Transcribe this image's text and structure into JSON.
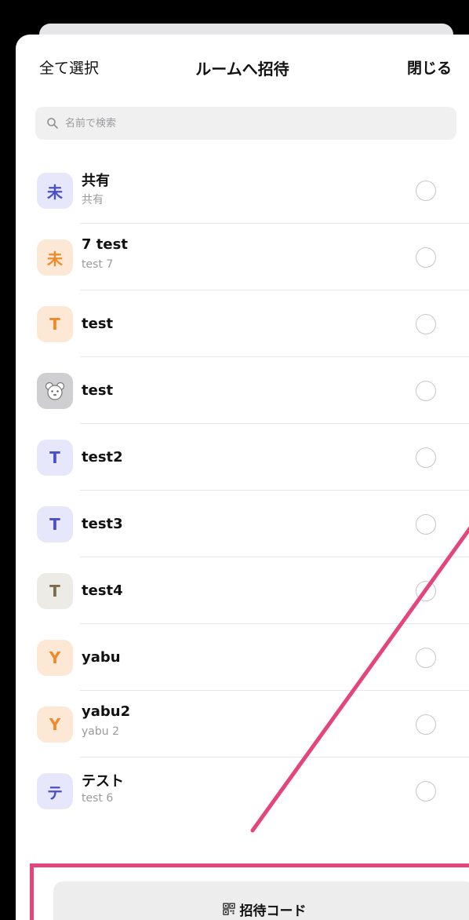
{
  "header": {
    "select_all": "全て選択",
    "title": "ルームへ招待",
    "close": "閉じる"
  },
  "search": {
    "placeholder": "名前で検索"
  },
  "rows": [
    {
      "avatar": "未",
      "name": "共有",
      "sub": "共有",
      "bg": "#e6e7fb",
      "fg": "#4b4fc7"
    },
    {
      "avatar": "未",
      "name": "7 test",
      "sub": "test 7",
      "bg": "#fde8d6",
      "fg": "#ef8a2a"
    },
    {
      "avatar": "T",
      "name": "test",
      "sub": "",
      "bg": "#fde8d6",
      "fg": "#ef8a2a"
    },
    {
      "avatar": "",
      "name": "test",
      "sub": "",
      "bg": "#cfcfd1",
      "fg": "#666",
      "icon": "bear-face-icon"
    },
    {
      "avatar": "T",
      "name": "test2",
      "sub": "",
      "bg": "#e6e7fb",
      "fg": "#4b4fc7"
    },
    {
      "avatar": "T",
      "name": "test3",
      "sub": "",
      "bg": "#e6e7fb",
      "fg": "#4b4fc7"
    },
    {
      "avatar": "T",
      "name": "test4",
      "sub": "",
      "bg": "#ecebe6",
      "fg": "#7b6b48"
    },
    {
      "avatar": "Y",
      "name": "yabu",
      "sub": "",
      "bg": "#fde8d6",
      "fg": "#ef8a2a"
    },
    {
      "avatar": "Y",
      "name": "yabu2",
      "sub": "yabu 2",
      "bg": "#fde8d6",
      "fg": "#ef8a2a"
    },
    {
      "avatar": "テ",
      "name": "テスト",
      "sub": "test 6",
      "bg": "#e6e7fb",
      "fg": "#4b4fc7"
    }
  ],
  "footer": {
    "invite_code": "招待コード"
  },
  "colors": {
    "highlight": "#e5467a"
  }
}
